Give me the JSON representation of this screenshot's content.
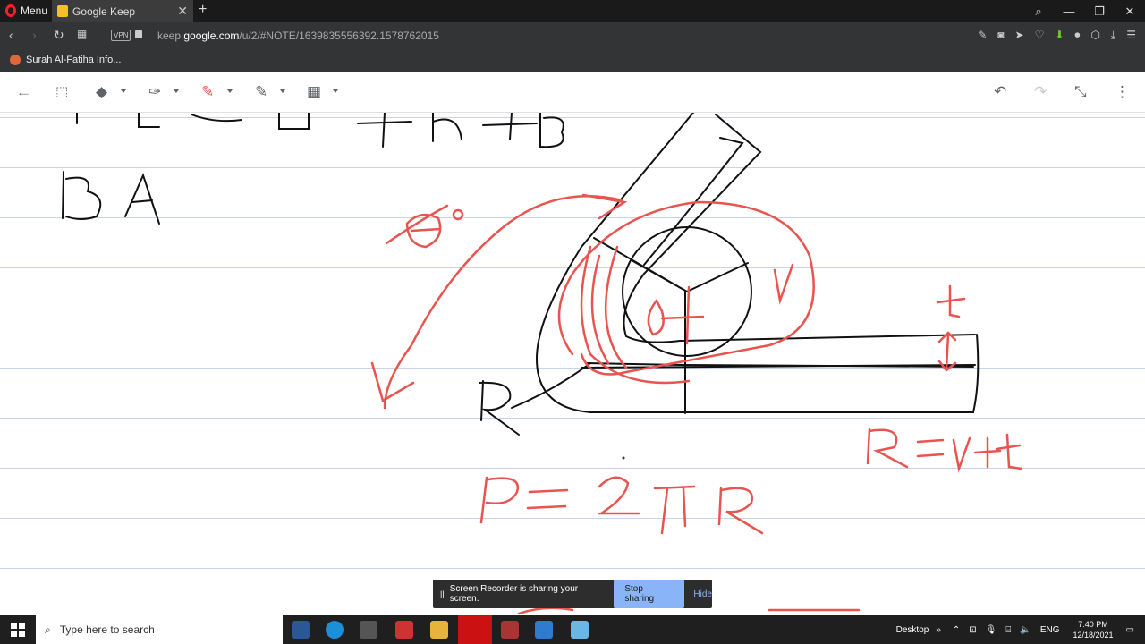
{
  "browser": {
    "menu_label": "Menu",
    "tab_title": "Google Keep",
    "tab_close": "✕",
    "new_tab": "+",
    "vpn_badge": "VPN",
    "url_prefix": "keep.",
    "url_domain": "google.com",
    "url_path": "/u/2/#NOTE/1639835556392.1578762015"
  },
  "bookmarks": [
    {
      "label": "Surah Al-Fatiha Info..."
    }
  ],
  "sketch_text": {
    "top_partial": "BA",
    "angle_label": "θ°",
    "r_label": "r",
    "t_label": "t",
    "R_label": "R",
    "formula_R": "R=r+t",
    "formula_P": "P= 2πR",
    "theta_inner": "θ"
  },
  "share_notice": {
    "pause_icon": "||",
    "message": "Screen Recorder is sharing your screen.",
    "stop_label": "Stop sharing",
    "hide_label": "Hide"
  },
  "taskbar": {
    "search_placeholder": "Type here to search",
    "desktop_label": "Desktop",
    "lang": "ENG",
    "time": "7:40 PM",
    "date": "12/18/2021"
  },
  "colors": {
    "ink_black": "#111111",
    "ink_red": "#e8544f",
    "rule": "#c9d3ea",
    "stop_button": "#8ab4f8"
  }
}
